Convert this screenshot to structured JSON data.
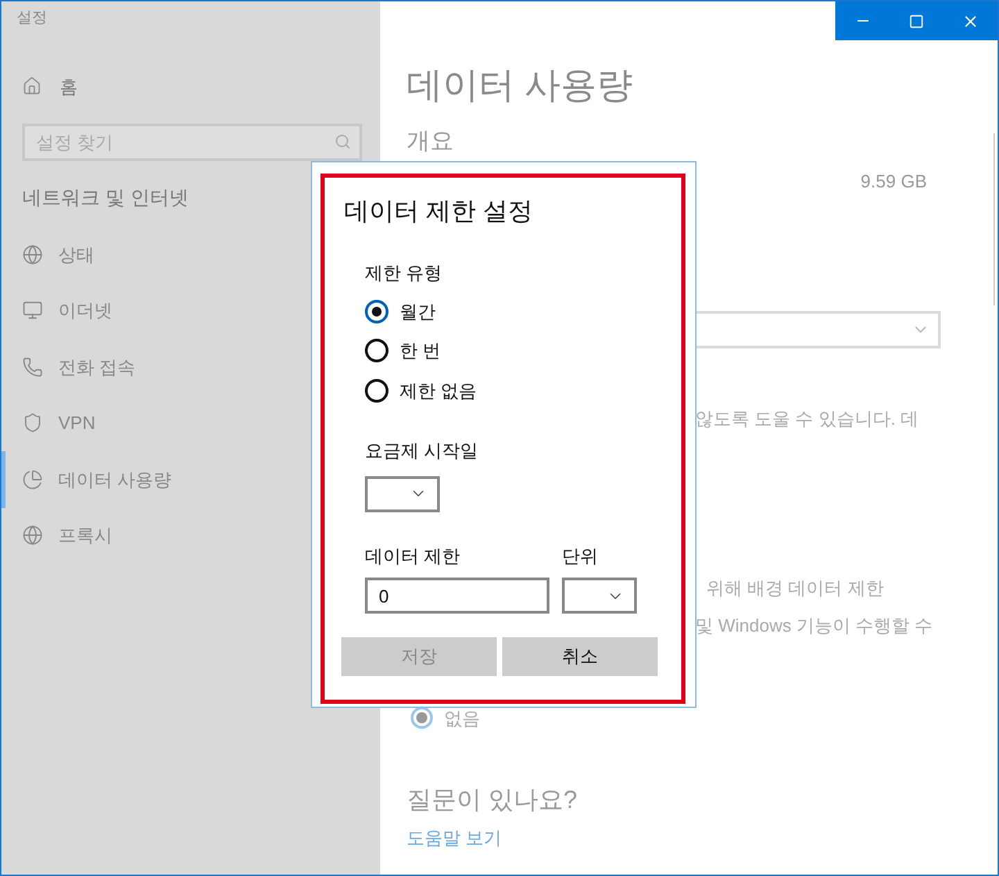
{
  "window": {
    "title": "설정"
  },
  "sidebar": {
    "home": "홈",
    "search": {
      "placeholder": "설정 찾기"
    },
    "section": "네트워크 및 인터넷",
    "items": [
      {
        "label": "상태",
        "selected": false,
        "kind": "globe"
      },
      {
        "label": "이더넷",
        "selected": false,
        "kind": "monitor"
      },
      {
        "label": "전화 접속",
        "selected": false,
        "kind": "phone"
      },
      {
        "label": "VPN",
        "selected": false,
        "kind": "vpn"
      },
      {
        "label": "데이터 사용량",
        "selected": true,
        "kind": "pie"
      },
      {
        "label": "프록시",
        "selected": false,
        "kind": "globe"
      }
    ]
  },
  "main": {
    "title": "데이터 사용량",
    "overview": "개요",
    "usage": "9.59 GB",
    "text_1": "않도록 도울 수 있습니다. 데",
    "text_2": "위해 배경 데이터 제한",
    "text_3": "및 Windows 기능이 수행할 수",
    "radio": {
      "label": "없음",
      "selected": true
    },
    "help_heading": "질문이 있나요?",
    "help_link": "도움말 보기"
  },
  "dialog": {
    "title": "데이터 제한 설정",
    "limit_type_label": "제한 유형",
    "options": [
      {
        "label": "월간",
        "selected": true
      },
      {
        "label": "한 번",
        "selected": false
      },
      {
        "label": "제한 없음",
        "selected": false
      }
    ],
    "start_date_label": "요금제 시작일",
    "data_limit_label": "데이터 제한",
    "data_limit_value": "0",
    "unit_label": "단위",
    "buttons": [
      {
        "label": "저장",
        "disabled": true
      },
      {
        "label": "취소",
        "disabled": false
      }
    ]
  }
}
